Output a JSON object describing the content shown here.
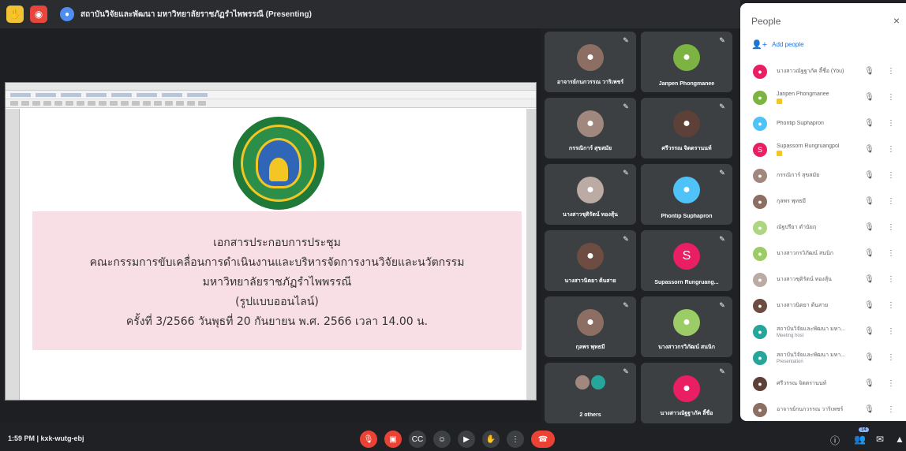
{
  "topbar": {
    "title": "สถาบันวิจัยและพัฒนา มหาวิทยาลัยราชภัฏรำไพพรรณี (Presenting)"
  },
  "document": {
    "lines": [
      "เอกสารประกอบการประชุม",
      "คณะกรรมการขับเคลื่อนการดำเนินงานและบริหารจัดการงานวิจัยและนวัตกรรม",
      "มหาวิทยาลัยราชภัฏรำไพพรรณี",
      "(รูปแบบออนไลน์)",
      "ครั้งที่ 3/2566 วันพุธที่ 20 กันยายน พ.ศ. 2566 เวลา 14.00 น."
    ]
  },
  "tiles": [
    {
      "name": "อาจารย์กนกวรรณ วาริเพชร์",
      "avatar_color": "#8d6e63",
      "initial": "●"
    },
    {
      "name": "Janpen Phongmanee",
      "avatar_color": "#7cb342",
      "initial": "●"
    },
    {
      "name": "กรรณิการ์ สุขสมัย",
      "avatar_color": "#a1887f",
      "initial": "●"
    },
    {
      "name": "ศรีวรรณ จิตตรานนท์",
      "avatar_color": "#5d4037",
      "initial": "●"
    },
    {
      "name": "นางสาวชุติรัตน์ ทองสุ้น",
      "avatar_color": "#bcaaa4",
      "initial": "●"
    },
    {
      "name": "Phontip Suphapron",
      "avatar_color": "#4fc3f7",
      "initial": "●"
    },
    {
      "name": "นางสาวนิตยา ต้นสาย",
      "avatar_color": "#6d4c41",
      "initial": "●"
    },
    {
      "name": "Supassorn Rungruang...",
      "avatar_color": "#e91e63",
      "initial": "S"
    },
    {
      "name": "กุลพร พุทธมี",
      "avatar_color": "#8d6e63",
      "initial": "●"
    },
    {
      "name": "นางสาวกรวิภัฒน์ สนนิก",
      "avatar_color": "#9ccc65",
      "initial": "●"
    },
    {
      "name": "2 others",
      "avatar_color": "#26a69a",
      "initial": ""
    },
    {
      "name": "นางสาวณัฐฐาภัค ลี้ชื่อ",
      "avatar_color": "#e91e63",
      "initial": "●"
    }
  ],
  "panel": {
    "title": "People",
    "close_icon": "×",
    "add_people": "Add people",
    "people": [
      {
        "name": "นางสาวณัฐฐาภัค ลี้ชื่อ (You)",
        "sub": "",
        "badge": false,
        "color": "#e91e63",
        "initial": "●"
      },
      {
        "name": "Janpen Phongmanee",
        "sub": "",
        "badge": true,
        "color": "#7cb342",
        "initial": "●"
      },
      {
        "name": "Phontip Suphapron",
        "sub": "",
        "badge": false,
        "color": "#4fc3f7",
        "initial": "●"
      },
      {
        "name": "Supassorn Rungruangpol",
        "sub": "",
        "badge": true,
        "color": "#e91e63",
        "initial": "S"
      },
      {
        "name": "กรรณิการ์ สุขสมัย",
        "sub": "",
        "badge": false,
        "color": "#a1887f",
        "initial": "●"
      },
      {
        "name": "กุลพร พุทธมี",
        "sub": "",
        "badge": false,
        "color": "#8d6e63",
        "initial": "●"
      },
      {
        "name": "ณัฐปรียา ตำนัยฤ",
        "sub": "",
        "badge": false,
        "color": "#aed581",
        "initial": "●"
      },
      {
        "name": "นางสาวกรวิภัฒน์ สนนิก",
        "sub": "",
        "badge": false,
        "color": "#9ccc65",
        "initial": "●"
      },
      {
        "name": "นางสาวชุติรัตน์ ทองสุ้น",
        "sub": "",
        "badge": false,
        "color": "#bcaaa4",
        "initial": "●"
      },
      {
        "name": "นางสาวนิตยา ต้นสาย",
        "sub": "",
        "badge": false,
        "color": "#6d4c41",
        "initial": "●"
      },
      {
        "name": "สถาบันวิจัยและพัฒนา มหา...",
        "sub": "Meeting host",
        "badge": false,
        "color": "#26a69a",
        "initial": "●"
      },
      {
        "name": "สถาบันวิจัยและพัฒนา มหา...",
        "sub": "Presentation",
        "badge": false,
        "color": "#26a69a",
        "initial": "●"
      },
      {
        "name": "ศรีวรรณ จิตตรานนท์",
        "sub": "",
        "badge": false,
        "color": "#5d4037",
        "initial": "●"
      },
      {
        "name": "อาจารย์กนกวรรณ วาริเพชร์",
        "sub": "",
        "badge": false,
        "color": "#8d6e63",
        "initial": "●"
      }
    ]
  },
  "bottombar": {
    "clock": "1:59 PM  |  kxk-wutg-ebj",
    "participant_count": "14"
  }
}
